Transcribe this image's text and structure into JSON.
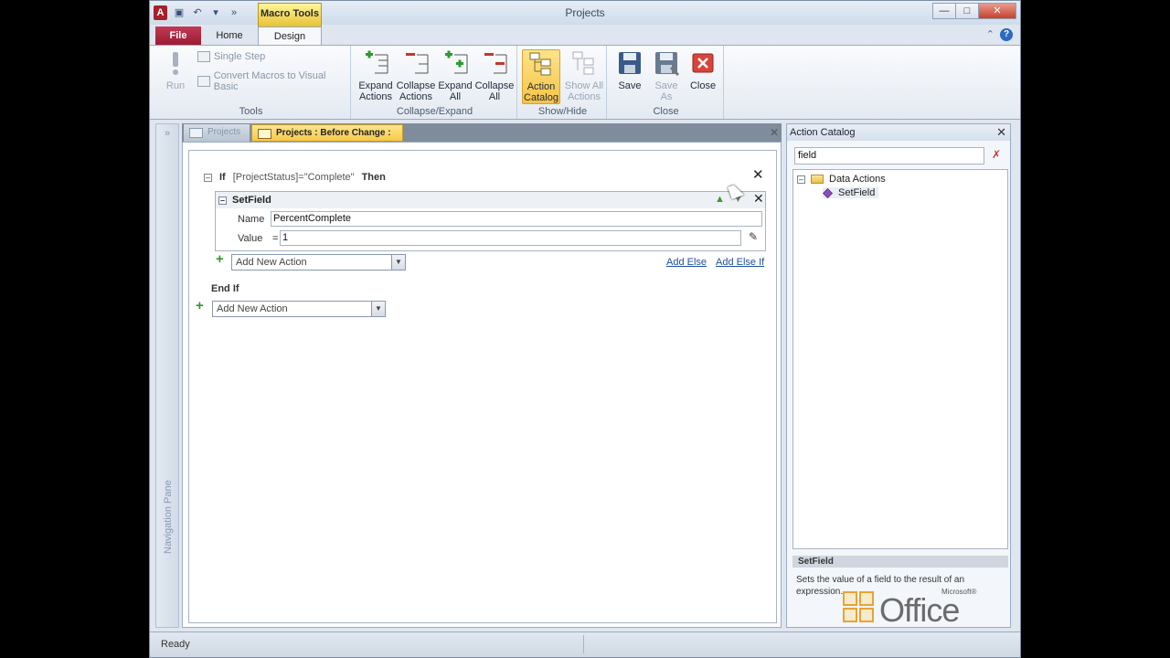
{
  "window": {
    "title": "Projects"
  },
  "ribbon_tabs": {
    "file": "File",
    "home": "Home",
    "design": "Design",
    "context": "Macro Tools"
  },
  "ribbon": {
    "tools": {
      "label": "Tools",
      "run": "Run",
      "single_step": "Single Step",
      "convert": "Convert Macros to Visual Basic"
    },
    "collapse_expand": {
      "label": "Collapse/Expand",
      "expand_actions_1": "Expand",
      "expand_actions_2": "Actions",
      "collapse_actions_1": "Collapse",
      "collapse_actions_2": "Actions",
      "expand_all_1": "Expand",
      "expand_all_2": "All",
      "collapse_all_1": "Collapse",
      "collapse_all_2": "All"
    },
    "show_hide": {
      "label": "Show/Hide",
      "action_catalog_1": "Action",
      "action_catalog_2": "Catalog",
      "show_all_1": "Show All",
      "show_all_2": "Actions"
    },
    "close": {
      "label": "Close",
      "save": "Save",
      "save_as_1": "Save",
      "save_as_2": "As",
      "close": "Close"
    }
  },
  "nav_pane": {
    "label": "Navigation Pane"
  },
  "doc_tabs": {
    "projects": "Projects",
    "active": "Projects : Before Change :"
  },
  "macro": {
    "if_kw": "If",
    "condition": "[ProjectStatus]=\"Complete\"",
    "then_kw": "Then",
    "action_name": "SetField",
    "args": {
      "name_label": "Name",
      "name_value": "PercentComplete",
      "value_label": "Value",
      "value_eq": "=",
      "value_value": "1"
    },
    "add_new_action": "Add New Action",
    "add_else": "Add Else",
    "add_else_if": "Add Else If",
    "end_if": "End If",
    "add_new_action_outer": "Add New Action"
  },
  "catalog": {
    "title": "Action Catalog",
    "search_value": "field",
    "tree": {
      "folder": "Data Actions",
      "item": "SetField"
    },
    "desc_title": "SetField",
    "desc": "Sets the value of a field to the result of an expression."
  },
  "logo": {
    "ms": "Microsoft®",
    "word": "Office"
  },
  "status": {
    "text": "Ready"
  }
}
